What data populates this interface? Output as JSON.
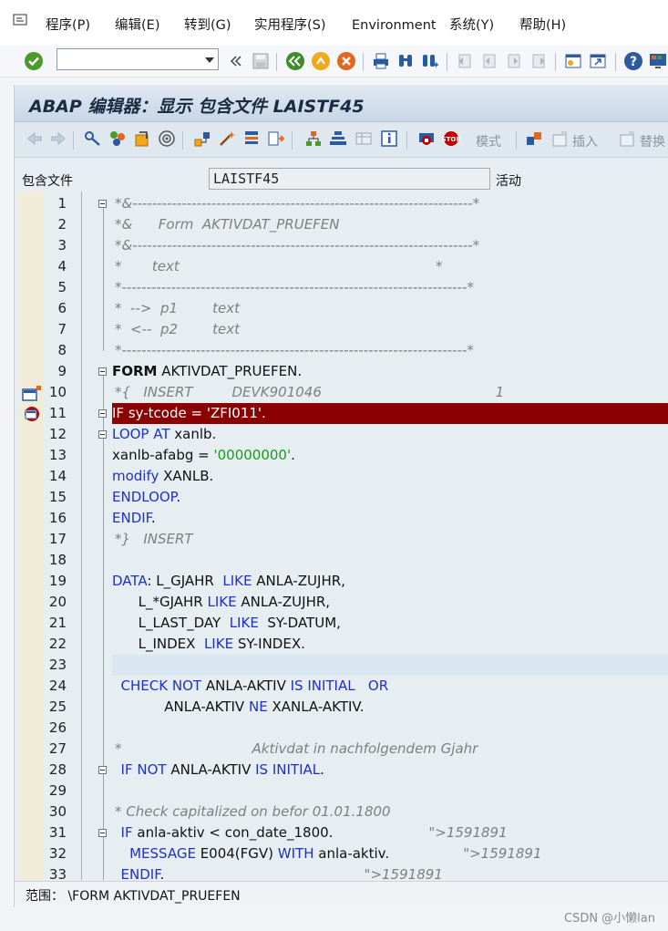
{
  "menu": {
    "items": [
      "程序(P)",
      "编辑(E)",
      "转到(G)",
      "实用程序(S)",
      "Environment",
      "系统(Y)",
      "帮助(H)"
    ]
  },
  "toolbar": {
    "command_field_value": "",
    "icons": [
      "enter-icon",
      "back-double-icon",
      "save-icon",
      "back-icon",
      "exit-icon",
      "cancel-icon",
      "print-icon",
      "find-icon",
      "find-next-icon",
      "first-page-icon",
      "prev-page-icon",
      "next-page-icon",
      "last-page-icon",
      "new-session-icon",
      "shortcut-icon",
      "help-icon",
      "layout-icon"
    ]
  },
  "title": "ABAP 编辑器：显示 包含文件 LAISTF45",
  "app_toolbar": {
    "mode_label": "模式",
    "insert_label": "插入",
    "replace_label": "替换"
  },
  "field": {
    "label": "包含文件",
    "value": "LAISTF45",
    "status": "活动"
  },
  "code_lines": [
    {
      "n": "1",
      "text": "*&---------------------------------------------------------------------*"
    },
    {
      "n": "2",
      "text": "*&      Form  AKTIVDAT_PRUEFEN"
    },
    {
      "n": "3",
      "text": "*&---------------------------------------------------------------------*"
    },
    {
      "n": "4",
      "text": "*       text                                                           *"
    },
    {
      "n": "5",
      "text": "*----------------------------------------------------------------------*"
    },
    {
      "n": "6",
      "text": "*  -->  p1        text"
    },
    {
      "n": "7",
      "text": "*  <--  p2        text"
    },
    {
      "n": "8",
      "text": "*----------------------------------------------------------------------*"
    },
    {
      "n": "9",
      "text": "FORM AKTIVDAT_PRUEFEN."
    },
    {
      "n": "10",
      "text": "*{   INSERT         DEVK901046                                        1"
    },
    {
      "n": "11",
      "text": "IF sy-tcode = 'ZFI011'."
    },
    {
      "n": "12",
      "text": "LOOP AT xanlb."
    },
    {
      "n": "13",
      "text": "xanlb-afabg = '00000000'."
    },
    {
      "n": "14",
      "text": "modify XANLB."
    },
    {
      "n": "15",
      "text": "ENDLOOP."
    },
    {
      "n": "16",
      "text": "ENDIF."
    },
    {
      "n": "17",
      "text": "*}   INSERT"
    },
    {
      "n": "18",
      "text": ""
    },
    {
      "n": "19",
      "text": "DATA: L_GJAHR  LIKE ANLA-ZUJHR,"
    },
    {
      "n": "20",
      "text": "      L_*GJAHR LIKE ANLA-ZUJHR,"
    },
    {
      "n": "21",
      "text": "      L_LAST_DAY  LIKE  SY-DATUM,"
    },
    {
      "n": "22",
      "text": "      L_INDEX  LIKE SY-INDEX."
    },
    {
      "n": "23",
      "text": ""
    },
    {
      "n": "24",
      "text": "  CHECK NOT ANLA-AKTIV IS INITIAL   OR"
    },
    {
      "n": "25",
      "text": "            ANLA-AKTIV NE XANLA-AKTIV."
    },
    {
      "n": "26",
      "text": ""
    },
    {
      "n": "27",
      "text": "*                              Aktivdat in nachfolgendem Gjahr"
    },
    {
      "n": "28",
      "text": "  IF NOT ANLA-AKTIV IS INITIAL."
    },
    {
      "n": "29",
      "text": ""
    },
    {
      "n": "30",
      "text": "* Check capitalized on befor 01.01.1800"
    },
    {
      "n": "31",
      "text": "  IF anla-aktiv < con_date_1800.                      \">1591891"
    },
    {
      "n": "32",
      "text": "    MESSAGE E004(FGV) WITH anla-aktiv.                 \">1591891"
    },
    {
      "n": "33",
      "text": "  ENDIF.                                              \">1591891"
    }
  ],
  "scope": {
    "label": "范围：",
    "value": "\\FORM AKTIVDAT_PRUEFEN"
  },
  "watermark": "CSDN @小懒lan",
  "colors": {
    "breakpoint_line": "#8b0000",
    "keyword": "#1f2fd0",
    "comment": "#7f7f7f",
    "string": "#1a9a1a",
    "cursor_line": "#d8e7f2"
  }
}
